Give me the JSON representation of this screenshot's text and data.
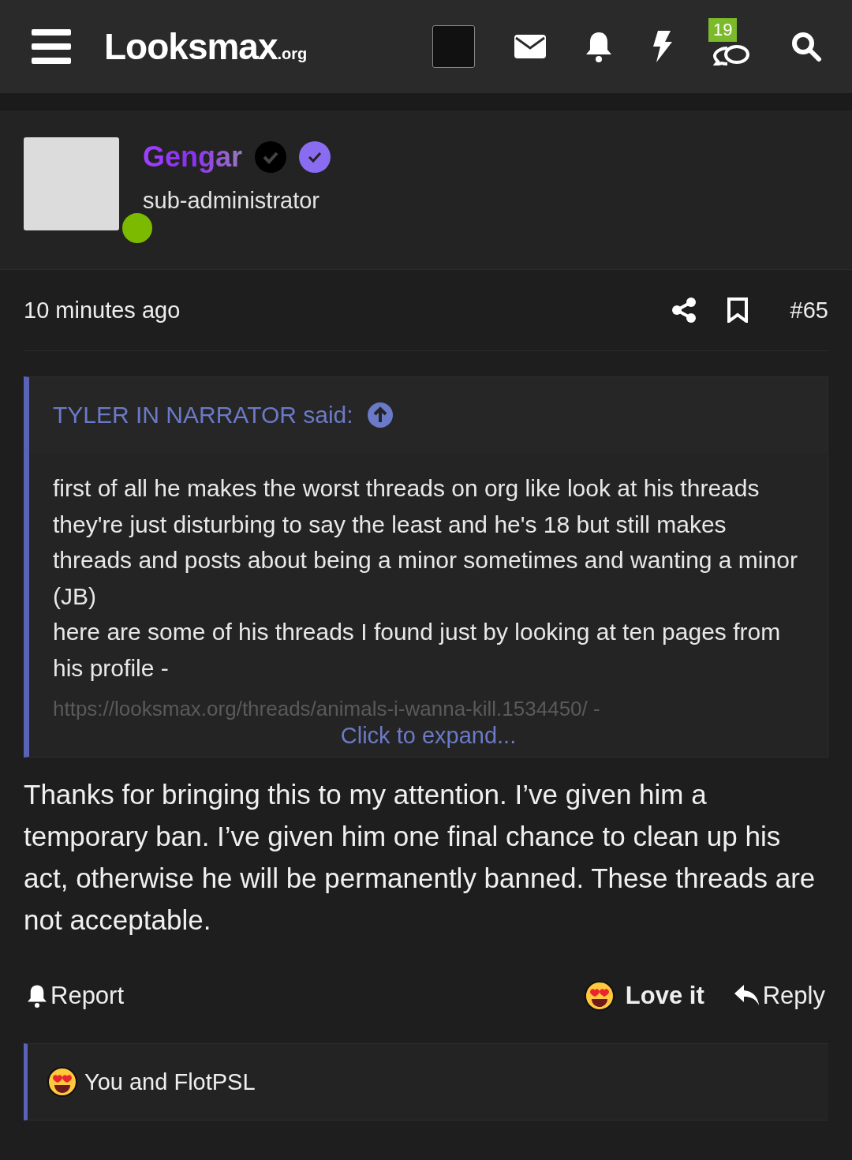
{
  "header": {
    "logo": {
      "name": "Looksmax",
      "suffix": ".org"
    },
    "notifications_badge": "19"
  },
  "post": {
    "author": {
      "name": "Gengar",
      "title": "sub-administrator",
      "online": true
    },
    "time": "10 minutes ago",
    "number": "#65",
    "quote": {
      "attribution": "TYLER IN NARRATOR said:",
      "paragraphs": [
        "first of all he makes the worst threads on org like look at his threads they're just disturbing to say the least and he's 18 but still makes threads and posts about being a minor sometimes and wanting a minor (JB)",
        "here are some of his threads I found just by looking at ten pages from his profile -"
      ],
      "faded_link": "https://looksmax.org/threads/animals-i-wanna-kill.1534450/ -",
      "expand": "Click to expand..."
    },
    "body": "Thanks for bringing this to my attention. I’ve given him a temporary ban. I’ve given him one final chance to clean up his act, otherwise he will be permanently banned. These threads are not acceptable.",
    "actions": {
      "report": "Report",
      "react": "Love it",
      "reply": "Reply"
    },
    "reactions": "You and FlotPSL"
  }
}
